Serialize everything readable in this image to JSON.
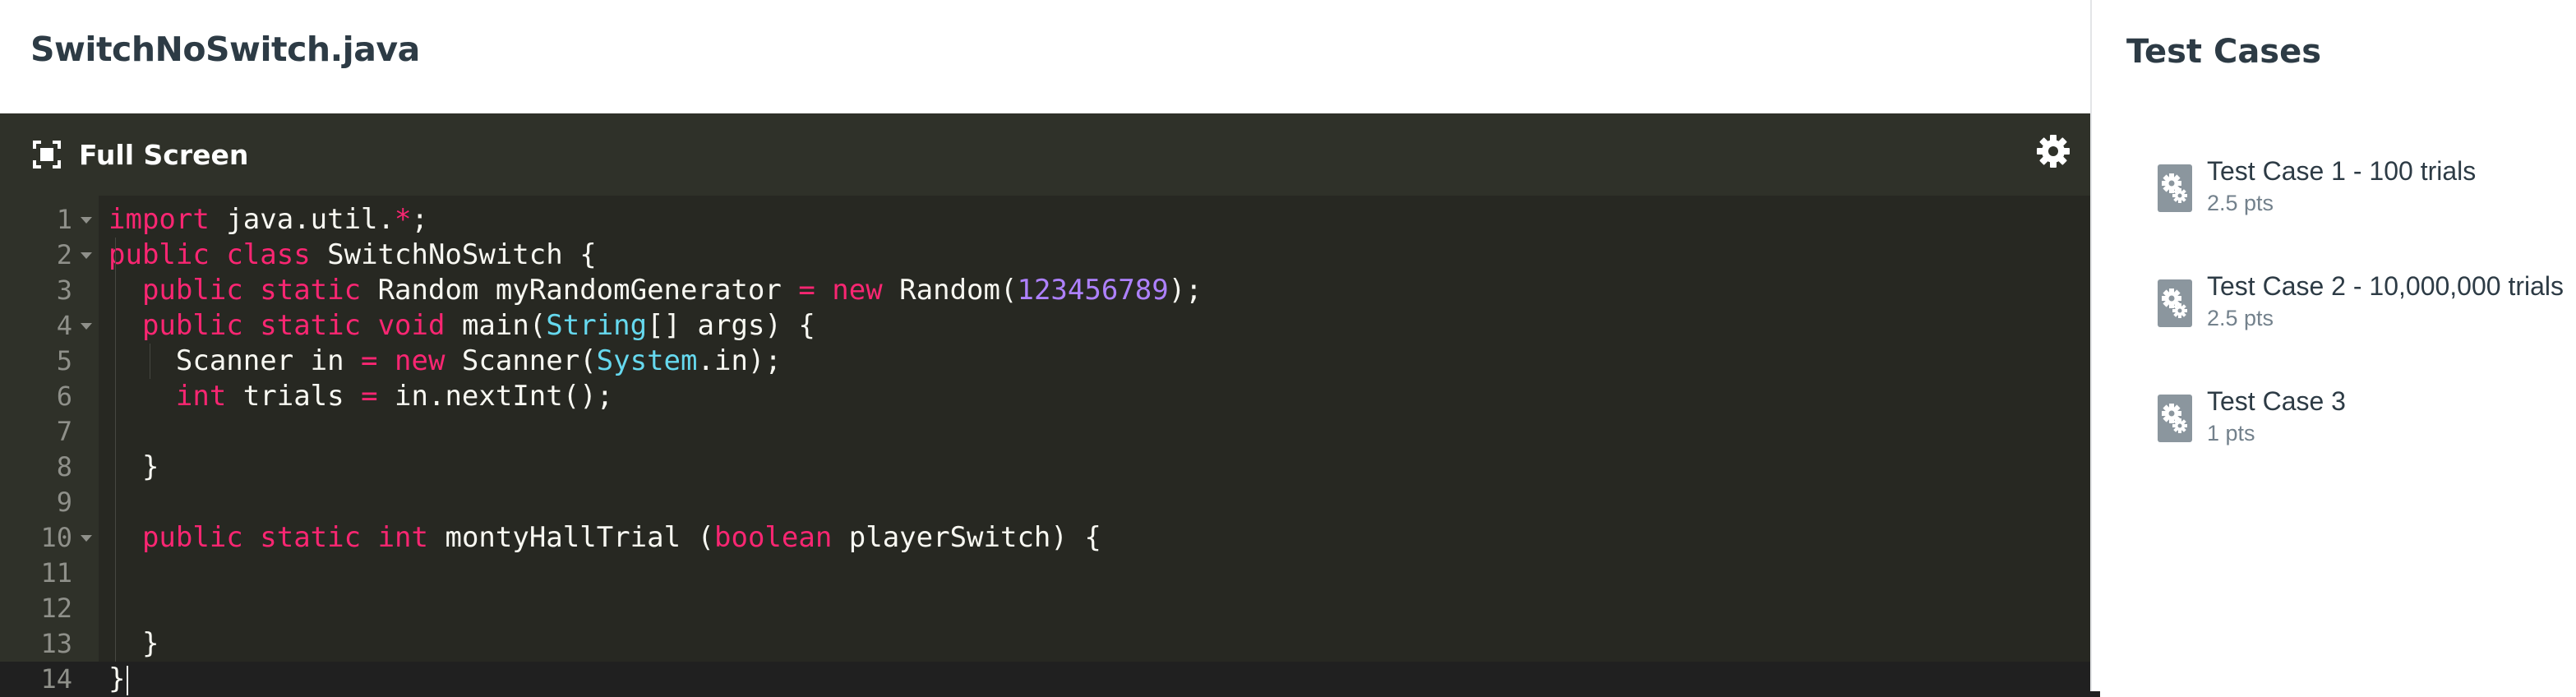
{
  "file": {
    "title": "SwitchNoSwitch.java"
  },
  "toolbar": {
    "full_screen_label": "Full Screen",
    "full_screen_icon": "fullscreen-icon",
    "settings_icon": "gear-icon"
  },
  "editor": {
    "language": "java",
    "active_line": 14,
    "colors": {
      "background": "#272822",
      "gutter": "#2f3129",
      "keyword": "#f92672",
      "type": "#66d9ef",
      "number": "#ae81ff",
      "text": "#f8f8f2"
    },
    "lines": [
      {
        "num": "1",
        "fold": true,
        "tokens": [
          {
            "t": "import",
            "c": "kw"
          },
          {
            "t": " java.util."
          },
          {
            "t": "*",
            "c": "kw"
          },
          {
            "t": ";"
          }
        ]
      },
      {
        "num": "2",
        "fold": true,
        "tokens": [
          {
            "t": "public",
            "c": "kw"
          },
          {
            "t": " "
          },
          {
            "t": "class",
            "c": "kw"
          },
          {
            "t": " SwitchNoSwitch {"
          }
        ]
      },
      {
        "num": "3",
        "fold": false,
        "tokens": [
          {
            "t": "  "
          },
          {
            "t": "public",
            "c": "kw"
          },
          {
            "t": " "
          },
          {
            "t": "static",
            "c": "kw"
          },
          {
            "t": " Random myRandomGenerator "
          },
          {
            "t": "=",
            "c": "kw"
          },
          {
            "t": " "
          },
          {
            "t": "new",
            "c": "kw"
          },
          {
            "t": " Random("
          },
          {
            "t": "123456789",
            "c": "nm"
          },
          {
            "t": ");"
          }
        ]
      },
      {
        "num": "4",
        "fold": true,
        "tokens": [
          {
            "t": "  "
          },
          {
            "t": "public",
            "c": "kw"
          },
          {
            "t": " "
          },
          {
            "t": "static",
            "c": "kw"
          },
          {
            "t": " "
          },
          {
            "t": "void",
            "c": "kw"
          },
          {
            "t": " main("
          },
          {
            "t": "String",
            "c": "ty"
          },
          {
            "t": "[] args) {"
          }
        ]
      },
      {
        "num": "5",
        "fold": false,
        "tokens": [
          {
            "t": "    Scanner in "
          },
          {
            "t": "=",
            "c": "kw"
          },
          {
            "t": " "
          },
          {
            "t": "new",
            "c": "kw"
          },
          {
            "t": " Scanner("
          },
          {
            "t": "System",
            "c": "ty"
          },
          {
            "t": ".in);"
          }
        ]
      },
      {
        "num": "6",
        "fold": false,
        "tokens": [
          {
            "t": "    "
          },
          {
            "t": "int",
            "c": "kw"
          },
          {
            "t": " trials "
          },
          {
            "t": "=",
            "c": "kw"
          },
          {
            "t": " in.nextInt();"
          }
        ]
      },
      {
        "num": "7",
        "fold": false,
        "tokens": []
      },
      {
        "num": "8",
        "fold": false,
        "tokens": [
          {
            "t": "  }"
          }
        ]
      },
      {
        "num": "9",
        "fold": false,
        "tokens": []
      },
      {
        "num": "10",
        "fold": true,
        "tokens": [
          {
            "t": "  "
          },
          {
            "t": "public",
            "c": "kw"
          },
          {
            "t": " "
          },
          {
            "t": "static",
            "c": "kw"
          },
          {
            "t": " "
          },
          {
            "t": "int",
            "c": "kw"
          },
          {
            "t": " montyHallTrial ("
          },
          {
            "t": "boolean",
            "c": "kw"
          },
          {
            "t": " playerSwitch) {"
          }
        ]
      },
      {
        "num": "11",
        "fold": false,
        "tokens": []
      },
      {
        "num": "12",
        "fold": false,
        "tokens": []
      },
      {
        "num": "13",
        "fold": false,
        "tokens": [
          {
            "t": "  }"
          }
        ]
      },
      {
        "num": "14",
        "fold": false,
        "tokens": [
          {
            "t": "}"
          }
        ]
      }
    ]
  },
  "test_cases": {
    "title": "Test Cases",
    "icon": "gears-icon",
    "items": [
      {
        "name": "Test Case 1 - 100 trials",
        "points": "2.5 pts"
      },
      {
        "name": "Test Case 2 - 10,000,000 trials",
        "points": "2.5 pts"
      },
      {
        "name": "Test Case 3",
        "points": "1 pts"
      }
    ]
  }
}
